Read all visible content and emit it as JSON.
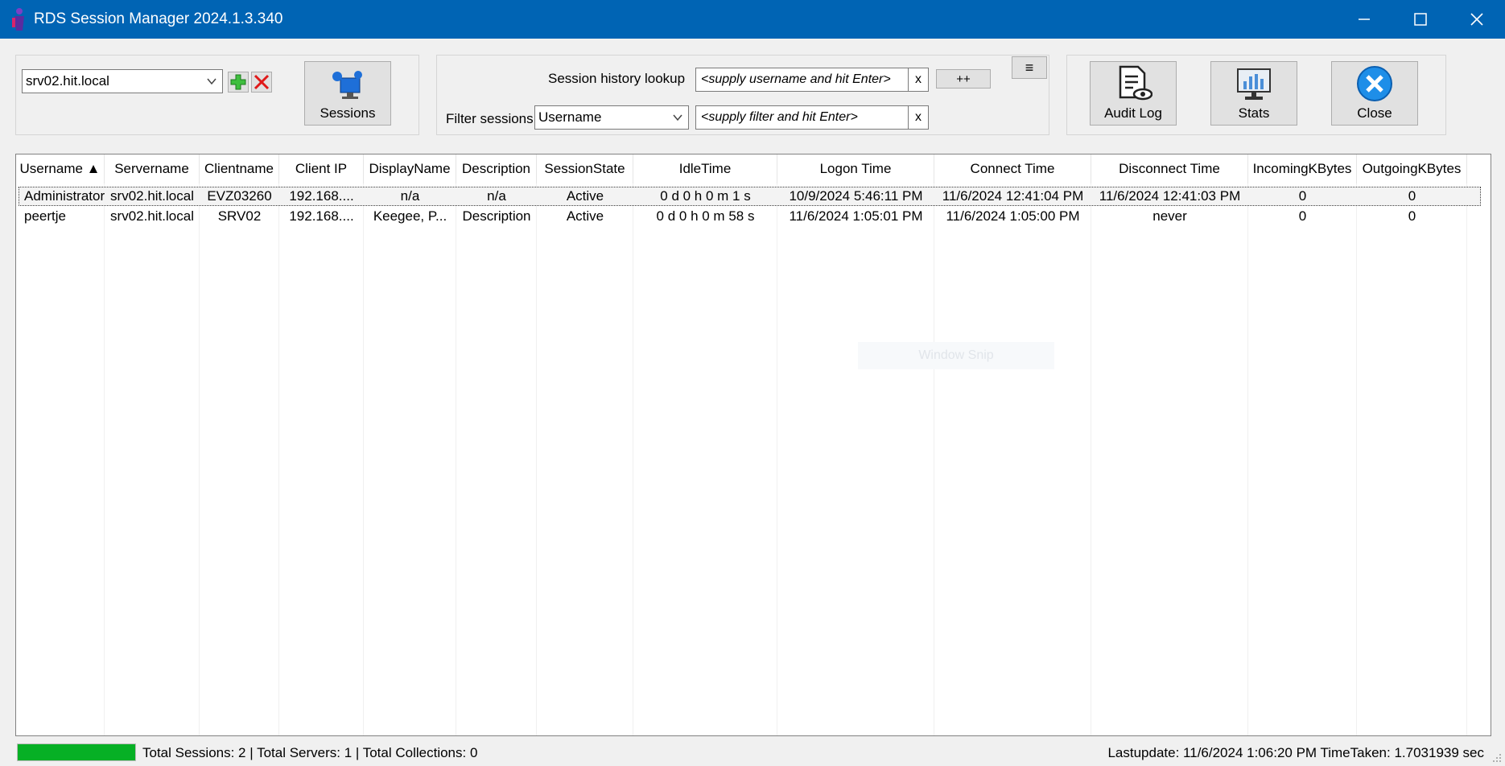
{
  "window": {
    "title": "RDS Session Manager 2024.1.3.340"
  },
  "server": {
    "selected": "srv02.hit.local",
    "sessions_label": "Sessions"
  },
  "lookup": {
    "history_label": "Session history lookup",
    "history_placeholder": "<supply username and hit Enter>",
    "history_clear": "x",
    "plus_label": "++",
    "menu_label": "≡",
    "filter_label": "Filter sessions",
    "filter_field": "Username",
    "filter_placeholder": "<supply filter and hit Enter>",
    "filter_clear": "x"
  },
  "actions": {
    "audit_label": "Audit Log",
    "stats_label": "Stats",
    "close_label": "Close"
  },
  "table": {
    "columns": [
      "Username ▲",
      "Servername",
      "Clientname",
      "Client IP",
      "DisplayName",
      "Description",
      "SessionState",
      "IdleTime",
      "Logon Time",
      "Connect Time",
      "Disconnect Time",
      "IncomingKBytes",
      "OutgoingKBytes"
    ],
    "rows": [
      [
        "Administrator",
        "srv02.hit.local",
        "EVZ03260",
        "192.168....",
        "n/a",
        "n/a",
        "Active",
        "0 d 0 h 0 m 1 s",
        "10/9/2024 5:46:11 PM",
        "11/6/2024 12:41:04 PM",
        "11/6/2024 12:41:03 PM",
        "0",
        "0"
      ],
      [
        "peertje",
        "srv02.hit.local",
        "SRV02",
        "192.168....",
        "Keegee, P...",
        "Description",
        "Active",
        "0 d 0 h 0 m 58 s",
        "11/6/2024 1:05:01 PM",
        "11/6/2024 1:05:00 PM",
        "never",
        "0",
        "0"
      ]
    ]
  },
  "ghost_text": "Window Snip",
  "status": {
    "progress": 1.0,
    "summary": "Total Sessions: 2  |  Total Servers: 1  |  Total Collections: 0",
    "lastupdate": "Lastupdate: 11/6/2024 1:06:20 PM  TimeTaken: 1.7031939 sec"
  },
  "colors": {
    "titlebar": "#0064b4",
    "progress": "#06b025",
    "close_icon": "#1e8ee8"
  }
}
